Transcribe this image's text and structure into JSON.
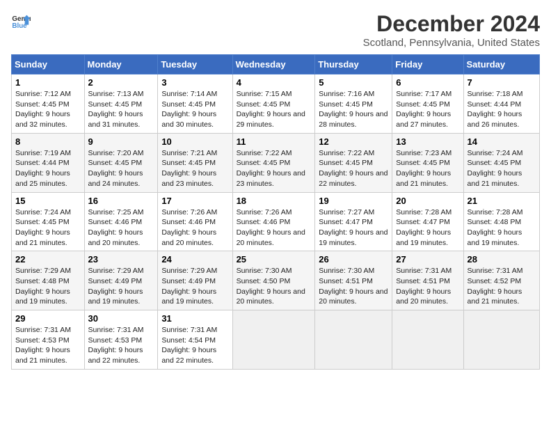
{
  "header": {
    "logo_line1": "General",
    "logo_line2": "Blue",
    "title": "December 2024",
    "subtitle": "Scotland, Pennsylvania, United States"
  },
  "days_of_week": [
    "Sunday",
    "Monday",
    "Tuesday",
    "Wednesday",
    "Thursday",
    "Friday",
    "Saturday"
  ],
  "weeks": [
    [
      {
        "day": "1",
        "sunrise": "7:12 AM",
        "sunset": "4:45 PM",
        "daylight": "9 hours and 32 minutes."
      },
      {
        "day": "2",
        "sunrise": "7:13 AM",
        "sunset": "4:45 PM",
        "daylight": "9 hours and 31 minutes."
      },
      {
        "day": "3",
        "sunrise": "7:14 AM",
        "sunset": "4:45 PM",
        "daylight": "9 hours and 30 minutes."
      },
      {
        "day": "4",
        "sunrise": "7:15 AM",
        "sunset": "4:45 PM",
        "daylight": "9 hours and 29 minutes."
      },
      {
        "day": "5",
        "sunrise": "7:16 AM",
        "sunset": "4:45 PM",
        "daylight": "9 hours and 28 minutes."
      },
      {
        "day": "6",
        "sunrise": "7:17 AM",
        "sunset": "4:45 PM",
        "daylight": "9 hours and 27 minutes."
      },
      {
        "day": "7",
        "sunrise": "7:18 AM",
        "sunset": "4:44 PM",
        "daylight": "9 hours and 26 minutes."
      }
    ],
    [
      {
        "day": "8",
        "sunrise": "7:19 AM",
        "sunset": "4:44 PM",
        "daylight": "9 hours and 25 minutes."
      },
      {
        "day": "9",
        "sunrise": "7:20 AM",
        "sunset": "4:45 PM",
        "daylight": "9 hours and 24 minutes."
      },
      {
        "day": "10",
        "sunrise": "7:21 AM",
        "sunset": "4:45 PM",
        "daylight": "9 hours and 23 minutes."
      },
      {
        "day": "11",
        "sunrise": "7:22 AM",
        "sunset": "4:45 PM",
        "daylight": "9 hours and 23 minutes."
      },
      {
        "day": "12",
        "sunrise": "7:22 AM",
        "sunset": "4:45 PM",
        "daylight": "9 hours and 22 minutes."
      },
      {
        "day": "13",
        "sunrise": "7:23 AM",
        "sunset": "4:45 PM",
        "daylight": "9 hours and 21 minutes."
      },
      {
        "day": "14",
        "sunrise": "7:24 AM",
        "sunset": "4:45 PM",
        "daylight": "9 hours and 21 minutes."
      }
    ],
    [
      {
        "day": "15",
        "sunrise": "7:24 AM",
        "sunset": "4:45 PM",
        "daylight": "9 hours and 21 minutes."
      },
      {
        "day": "16",
        "sunrise": "7:25 AM",
        "sunset": "4:46 PM",
        "daylight": "9 hours and 20 minutes."
      },
      {
        "day": "17",
        "sunrise": "7:26 AM",
        "sunset": "4:46 PM",
        "daylight": "9 hours and 20 minutes."
      },
      {
        "day": "18",
        "sunrise": "7:26 AM",
        "sunset": "4:46 PM",
        "daylight": "9 hours and 20 minutes."
      },
      {
        "day": "19",
        "sunrise": "7:27 AM",
        "sunset": "4:47 PM",
        "daylight": "9 hours and 19 minutes."
      },
      {
        "day": "20",
        "sunrise": "7:28 AM",
        "sunset": "4:47 PM",
        "daylight": "9 hours and 19 minutes."
      },
      {
        "day": "21",
        "sunrise": "7:28 AM",
        "sunset": "4:48 PM",
        "daylight": "9 hours and 19 minutes."
      }
    ],
    [
      {
        "day": "22",
        "sunrise": "7:29 AM",
        "sunset": "4:48 PM",
        "daylight": "9 hours and 19 minutes."
      },
      {
        "day": "23",
        "sunrise": "7:29 AM",
        "sunset": "4:49 PM",
        "daylight": "9 hours and 19 minutes."
      },
      {
        "day": "24",
        "sunrise": "7:29 AM",
        "sunset": "4:49 PM",
        "daylight": "9 hours and 19 minutes."
      },
      {
        "day": "25",
        "sunrise": "7:30 AM",
        "sunset": "4:50 PM",
        "daylight": "9 hours and 20 minutes."
      },
      {
        "day": "26",
        "sunrise": "7:30 AM",
        "sunset": "4:51 PM",
        "daylight": "9 hours and 20 minutes."
      },
      {
        "day": "27",
        "sunrise": "7:31 AM",
        "sunset": "4:51 PM",
        "daylight": "9 hours and 20 minutes."
      },
      {
        "day": "28",
        "sunrise": "7:31 AM",
        "sunset": "4:52 PM",
        "daylight": "9 hours and 21 minutes."
      }
    ],
    [
      {
        "day": "29",
        "sunrise": "7:31 AM",
        "sunset": "4:53 PM",
        "daylight": "9 hours and 21 minutes."
      },
      {
        "day": "30",
        "sunrise": "7:31 AM",
        "sunset": "4:53 PM",
        "daylight": "9 hours and 22 minutes."
      },
      {
        "day": "31",
        "sunrise": "7:31 AM",
        "sunset": "4:54 PM",
        "daylight": "9 hours and 22 minutes."
      },
      null,
      null,
      null,
      null
    ]
  ]
}
